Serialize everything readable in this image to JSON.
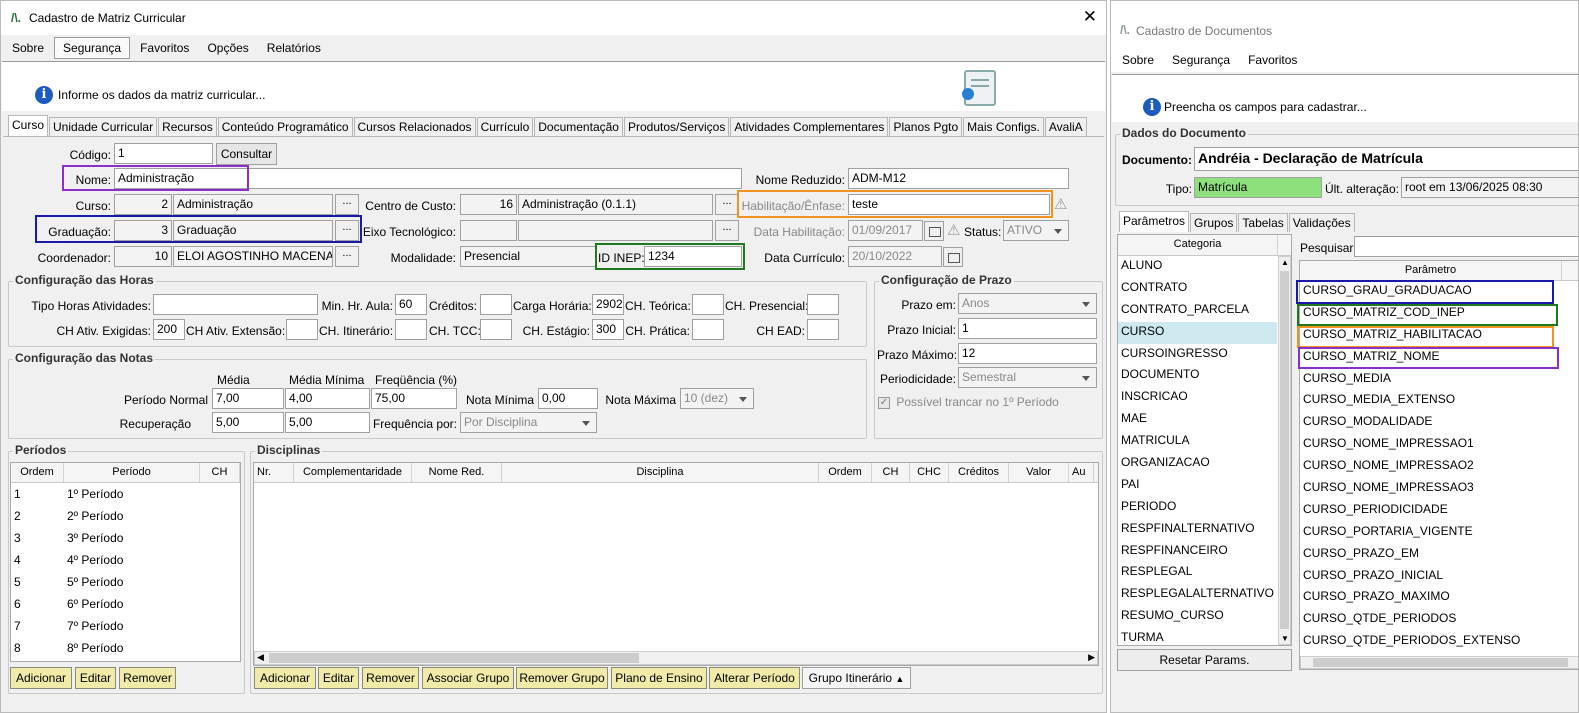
{
  "main_window": {
    "title": "Cadastro de Matriz Curricular",
    "menu": [
      "Sobre",
      "Segurança",
      "Favoritos",
      "Opções",
      "Relatórios"
    ],
    "info_message": "Informe os dados da matriz curricular...",
    "tabs": [
      "Curso",
      "Unidade Curricular",
      "Recursos",
      "Conteúdo Programático",
      "Cursos Relacionados",
      "Currículo",
      "Documentação",
      "Produtos/Serviços",
      "Atividades Complementares",
      "Planos Pgto",
      "Mais Configs.",
      "AvaliA"
    ],
    "active_tab": "Curso",
    "form": {
      "codigo_label": "Código:",
      "codigo": "1",
      "consultar_label": "Consultar",
      "nome_label": "Nome:",
      "nome": "Administração",
      "nome_reduzido_label": "Nome Reduzido:",
      "nome_reduzido": "ADM-M12",
      "curso_label": "Curso:",
      "curso_id": "2",
      "curso": "Administração",
      "centro_custo_label": "Centro de Custo:",
      "centro_custo_id": "16",
      "centro_custo": "Administração (0.1.1)",
      "habilitacao_label": "Habilitação/Ênfase:",
      "habilitacao": "teste",
      "graduacao_label": "Graduação:",
      "graduacao_id": "3",
      "graduacao": "Graduação",
      "eixo_label": "Eixo Tecnológico:",
      "data_habilitacao_label": "Data Habilitação:",
      "data_habilitacao": "01/09/2017",
      "status_label": "Status:",
      "status": "ATIVO",
      "coordenador_label": "Coordenador:",
      "coordenador_id": "10",
      "coordenador": "ELOI AGOSTINHO MACENA",
      "modalidade_label": "Modalidade:",
      "modalidade": "Presencial",
      "id_inep_label": "ID INEP:",
      "id_inep": "1234",
      "data_curriculo_label": "Data Currículo:",
      "data_curriculo": "20/10/2022",
      "dots": "..."
    },
    "horas": {
      "title": "Configuração das Horas",
      "tipo_horas_label": "Tipo Horas Atividades:",
      "min_hr_aula_label": "Min. Hr. Aula:",
      "min_hr_aula": "60",
      "creditos_label": "Créditos:",
      "carga_horaria_label": "Carga Horária:",
      "carga_horaria": "2902",
      "ch_teorica_label": "CH. Teórica:",
      "ch_presencial_label": "CH. Presencial:",
      "ch_ativ_exigidas_label": "CH Ativ. Exigidas:",
      "ch_ativ_exigidas": "200",
      "ch_ativ_extensao_label": "CH Ativ. Extensão:",
      "ch_itinerario_label": "CH. Itinerário:",
      "ch_tcc_label": "CH. TCC:",
      "ch_estagio_label": "CH. Estágio:",
      "ch_estagio": "300",
      "ch_pratica_label": "CH. Prática:",
      "ch_ead_label": "CH EAD:"
    },
    "prazo": {
      "title": "Configuração de Prazo",
      "prazo_em_label": "Prazo em:",
      "prazo_em": "Anos",
      "prazo_inicial_label": "Prazo Inicial:",
      "prazo_inicial": "1",
      "prazo_maximo_label": "Prazo Máximo:",
      "prazo_maximo": "12",
      "periodicidade_label": "Periodicidade:",
      "periodicidade": "Semestral",
      "trancar_label": "Possível trancar no 1º Período"
    },
    "notas": {
      "title": "Configuração das Notas",
      "media_header": "Média",
      "media_minima_header": "Média Mínima",
      "frequencia_header": "Freqüência (%)",
      "periodo_normal_label": "Período Normal",
      "pn_media": "7,00",
      "pn_media_minima": "4,00",
      "pn_frequencia": "75,00",
      "nota_minima_label": "Nota Mínima",
      "nota_minima": "0,00",
      "nota_maxima_label": "Nota Máxima",
      "nota_maxima": "10 (dez)",
      "recuperacao_label": "Recuperação",
      "rec_media": "5,00",
      "rec_media_minima": "5,00",
      "frequencia_por_label": "Frequência por:",
      "frequencia_por": "Por Disciplina"
    },
    "periodos": {
      "title": "Períodos",
      "columns": [
        "Ordem",
        "Período",
        "CH"
      ],
      "rows": [
        [
          "1",
          "1º Período"
        ],
        [
          "2",
          "2º Período"
        ],
        [
          "3",
          "3º Período"
        ],
        [
          "4",
          "4º Período"
        ],
        [
          "5",
          "5º Período"
        ],
        [
          "6",
          "6º Período"
        ],
        [
          "7",
          "7º Período"
        ],
        [
          "8",
          "8º Período"
        ]
      ],
      "buttons": [
        "Adicionar",
        "Editar",
        "Remover"
      ]
    },
    "disciplinas": {
      "title": "Disciplinas",
      "columns": [
        "Nr.",
        "Complementaridade",
        "Nome Red.",
        "Disciplina",
        "Ordem",
        "CH",
        "CHC",
        "Créditos",
        "Valor",
        "Au"
      ],
      "buttons": [
        "Adicionar",
        "Editar",
        "Remover",
        "Associar Grupo",
        "Remover Grupo",
        "Plano de Ensino",
        "Alterar Período",
        "Grupo Itinerário"
      ]
    }
  },
  "doc_window": {
    "title": "Cadastro de Documentos",
    "menu": [
      "Sobre",
      "Segurança",
      "Favoritos"
    ],
    "info_message": "Preencha os campos para cadastrar...",
    "group_title": "Dados do Documento",
    "documento_label": "Documento:",
    "documento": "Andréia - Declaração de Matrícula",
    "tipo_label": "Tipo:",
    "tipo": "Matrícula",
    "ult_alteracao_label": "Últ. alteração:",
    "ult_alteracao": "root em 13/06/2025 08:30",
    "tabs": [
      "Parâmetros",
      "Grupos",
      "Tabelas",
      "Validações"
    ],
    "categoria_header": "Categoria",
    "categorias": [
      "ALUNO",
      "CONTRATO",
      "CONTRATO_PARCELA",
      "CURSO",
      "CURSOINGRESSO",
      "DOCUMENTO",
      "INSCRICAO",
      "MAE",
      "MATRICULA",
      "ORGANIZACAO",
      "PAI",
      "PERIODO",
      "RESPFINALTERNATIVO",
      "RESPFINANCEIRO",
      "RESPLEGAL",
      "RESPLEGALALTERNATIVO",
      "RESUMO_CURSO",
      "TURMA"
    ],
    "selected_categoria": "CURSO",
    "pesquisar_label": "Pesquisar:",
    "parametro_header": "Parâmetro",
    "parametros": [
      "CURSO_GRAU_GRADUACAO",
      "CURSO_MATRIZ_COD_INEP",
      "CURSO_MATRIZ_HABILITACAO",
      "CURSO_MATRIZ_NOME",
      "CURSO_MEDIA",
      "CURSO_MEDIA_EXTENSO",
      "CURSO_MODALIDADE",
      "CURSO_NOME_IMPRESSAO1",
      "CURSO_NOME_IMPRESSAO2",
      "CURSO_NOME_IMPRESSAO3",
      "CURSO_PERIODICIDADE",
      "CURSO_PORTARIA_VIGENTE",
      "CURSO_PRAZO_EM",
      "CURSO_PRAZO_INICIAL",
      "CURSO_PRAZO_MAXIMO",
      "CURSO_QTDE_PERIODOS",
      "CURSO_QTDE_PERIODOS_EXTENSO"
    ],
    "reset_label": "Resetar Params."
  },
  "colors": {
    "highlight_purple": "#8b2fc9",
    "highlight_blue": "#1a1aa8",
    "highlight_green": "#1f7a1f",
    "highlight_orange": "#f0921e",
    "tipo_bg": "#8ee07c",
    "button_yellow": "#f0eba8",
    "selected_row": "#cde8ee"
  }
}
